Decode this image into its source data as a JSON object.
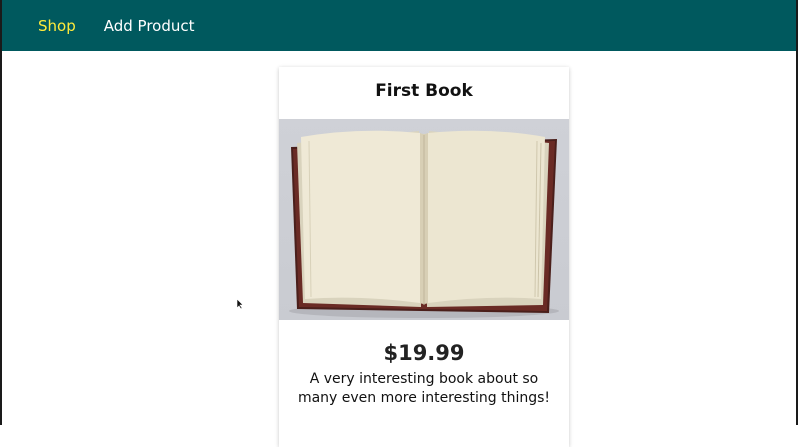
{
  "nav": {
    "shop_label": "Shop",
    "add_product_label": "Add Product",
    "active": "Shop"
  },
  "product": {
    "title": "First Book",
    "price": "$19.99",
    "description": "A very interesting book about so many even more interesting things!",
    "image_icon": "open-book-photo"
  },
  "colors": {
    "navbar": "#00595e",
    "active_link": "#ffeb3b",
    "link": "#ffffff"
  }
}
